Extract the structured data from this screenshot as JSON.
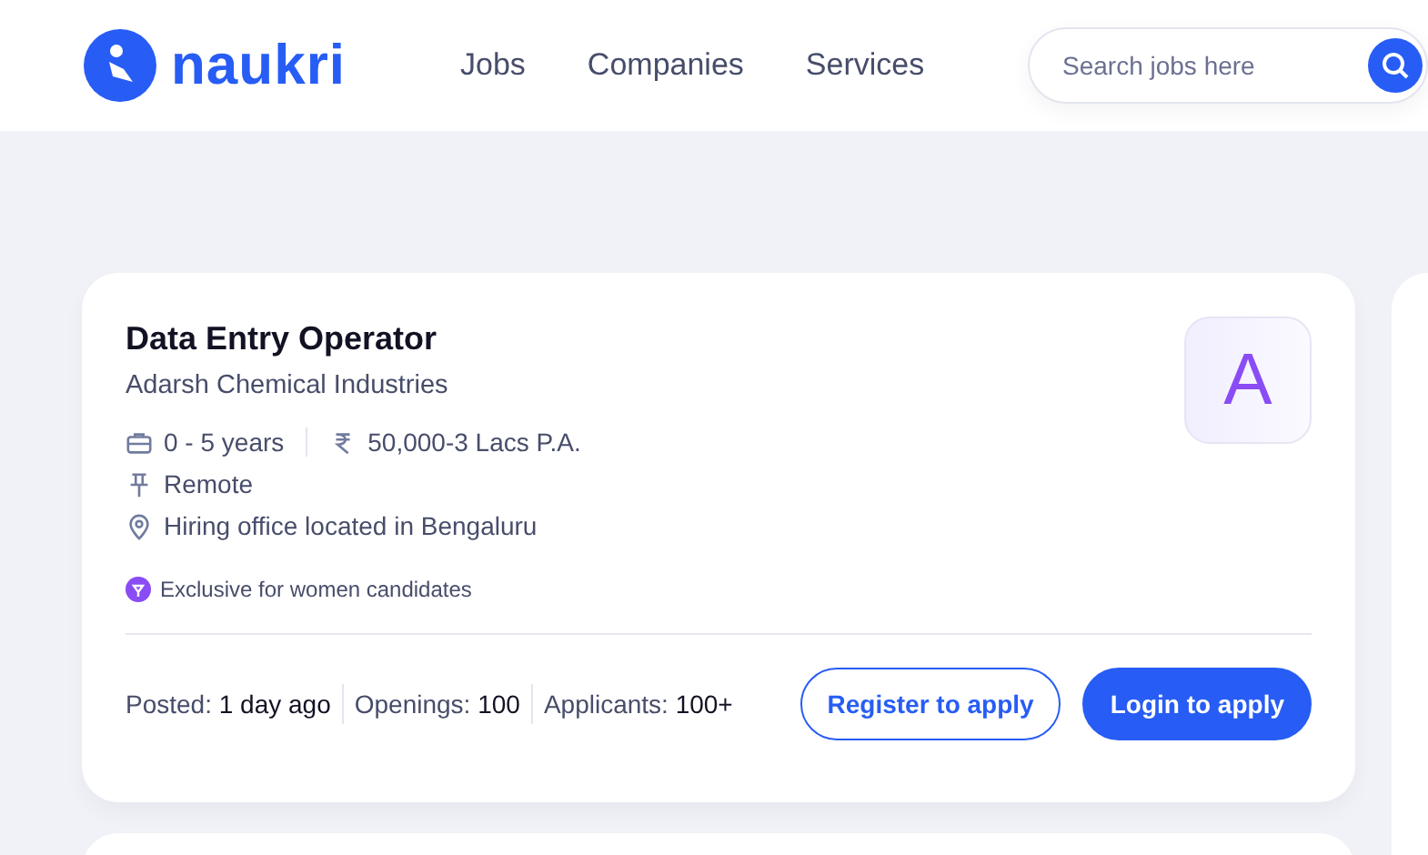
{
  "header": {
    "logo": "naukri",
    "nav": [
      "Jobs",
      "Companies",
      "Services"
    ],
    "search": {
      "placeholder": "Search jobs here"
    }
  },
  "job": {
    "title": "Data Entry Operator",
    "company": "Adarsh Chemical Industries",
    "logo_letter": "A",
    "experience": "0 - 5 years",
    "salary": "50,000-3 Lacs P.A.",
    "work_mode": "Remote",
    "location": "Hiring office located in Bengaluru",
    "tag": "Exclusive for women candidates",
    "stats": [
      {
        "label": "Posted:",
        "value": "1 day ago"
      },
      {
        "label": "Openings:",
        "value": "100"
      },
      {
        "label": "Applicants:",
        "value": "100+"
      }
    ],
    "buttons": [
      {
        "label": "Register to apply",
        "kind": "outline"
      },
      {
        "label": "Login to apply",
        "kind": "filled"
      }
    ]
  }
}
